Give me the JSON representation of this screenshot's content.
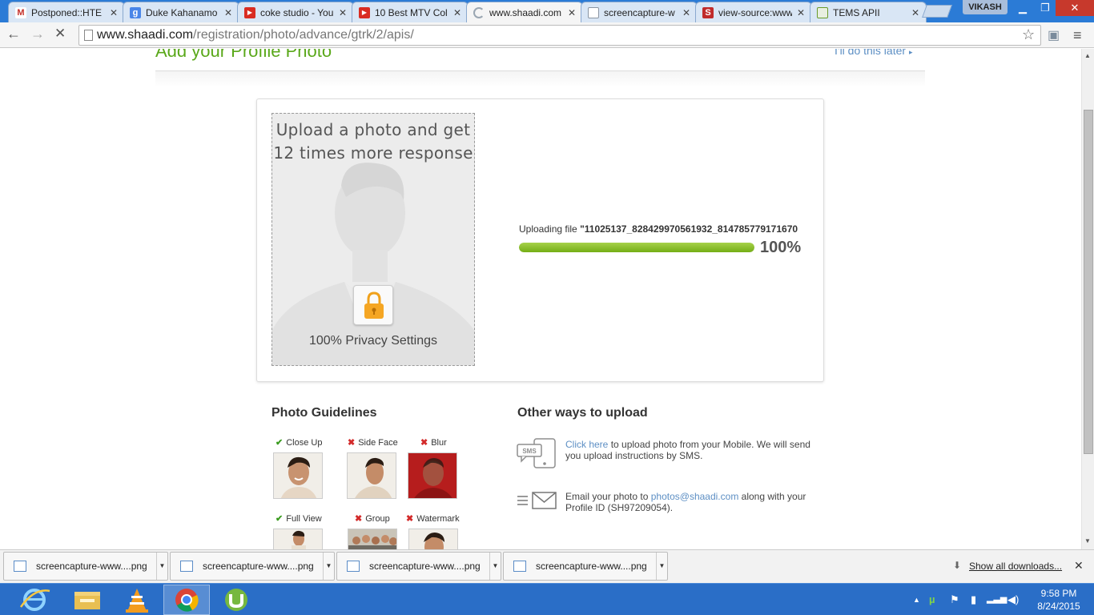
{
  "browser": {
    "tabs": [
      {
        "title": "Postponed::HTE",
        "color": "#c5312b"
      },
      {
        "title": "Duke Kahanamo",
        "color": "#4a86e8"
      },
      {
        "title": "coke studio - You",
        "color": "#d92c22"
      },
      {
        "title": "10 Best MTV Col",
        "color": "#d92c22"
      },
      {
        "title": "www.shaadi.com",
        "color": "#9aa6b2"
      },
      {
        "title": "screencapture-w",
        "color": "#8a95a3"
      },
      {
        "title": "view-source:www",
        "color": "#c02b2b"
      },
      {
        "title": "TEMS APII",
        "color": "#6a9b2a"
      }
    ],
    "user_name": "VIKASH",
    "url_host": "www.shaadi.com",
    "url_path": "/registration/photo/advance/gtrk/2/apis/"
  },
  "page": {
    "title": "Add your Profile Photo",
    "skip_label": "I'll do this later",
    "photo_prompt_line1": "Upload a photo and get",
    "photo_prompt_line2": "12 times more response",
    "privacy_label": "100% Privacy Settings",
    "upload_prefix": "Uploading file ",
    "upload_filename": "\"11025137_828429970561932_814785779171670",
    "upload_progress": 1.0,
    "progress_text": "100%",
    "guidelines_heading": "Photo Guidelines",
    "guidelines": [
      {
        "label": "Close Up",
        "ok": true
      },
      {
        "label": "Side Face",
        "ok": false
      },
      {
        "label": "Blur",
        "ok": false
      },
      {
        "label": "Full View",
        "ok": true
      },
      {
        "label": "Group",
        "ok": false
      },
      {
        "label": "Watermark",
        "ok": false
      }
    ],
    "other_heading": "Other ways to upload",
    "sms_icon_label": "SMS",
    "sms_link": "Click here",
    "sms_text": " to upload photo from your Mobile. We will send you upload instructions by SMS.",
    "email_prefix": "Email your photo to ",
    "email_link": "photos@shaadi.com",
    "email_suffix": " along with your Profile ID (SH97209054)."
  },
  "downloads": {
    "items": [
      "screencapture-www....png",
      "screencapture-www....png",
      "screencapture-www....png",
      "screencapture-www....png"
    ],
    "show_all": "Show all downloads..."
  },
  "taskbar": {
    "time": "9:58 PM",
    "date": "8/24/2015"
  },
  "colors": {
    "accent_green": "#5aa81a",
    "link_blue": "#5d8fc4",
    "taskbar_blue": "#2a6ec7"
  }
}
